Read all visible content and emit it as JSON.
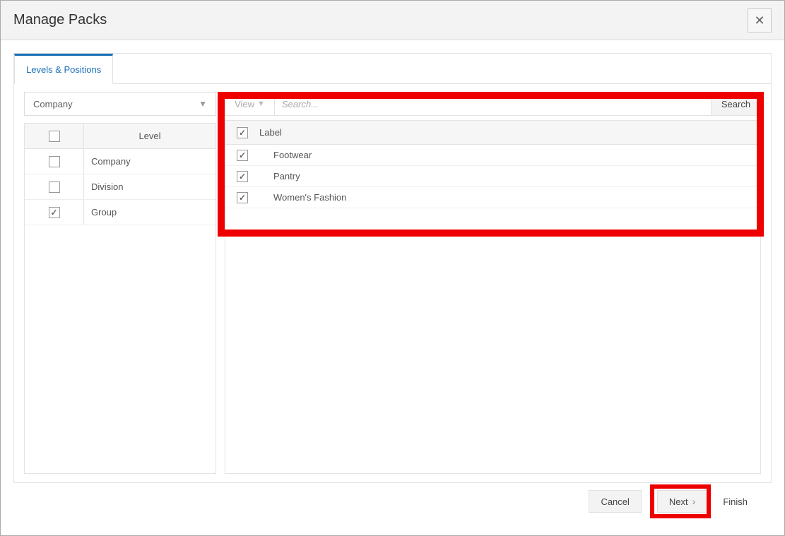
{
  "window": {
    "title": "Manage Packs"
  },
  "tabs": {
    "active": "Levels & Positions"
  },
  "dropdown": {
    "selected": "Company"
  },
  "level_table": {
    "header": "Level",
    "rows": [
      {
        "checked": false,
        "label": "Company"
      },
      {
        "checked": false,
        "label": "Division"
      },
      {
        "checked": true,
        "label": "Group"
      }
    ]
  },
  "right": {
    "view_button": "View",
    "search_placeholder": "Search...",
    "search_button": "Search",
    "header": "Label",
    "rows": [
      {
        "checked": true,
        "label": "Footwear"
      },
      {
        "checked": true,
        "label": "Pantry"
      },
      {
        "checked": true,
        "label": "Women's Fashion"
      }
    ]
  },
  "footer": {
    "cancel": "Cancel",
    "next": "Next",
    "finish": "Finish"
  }
}
